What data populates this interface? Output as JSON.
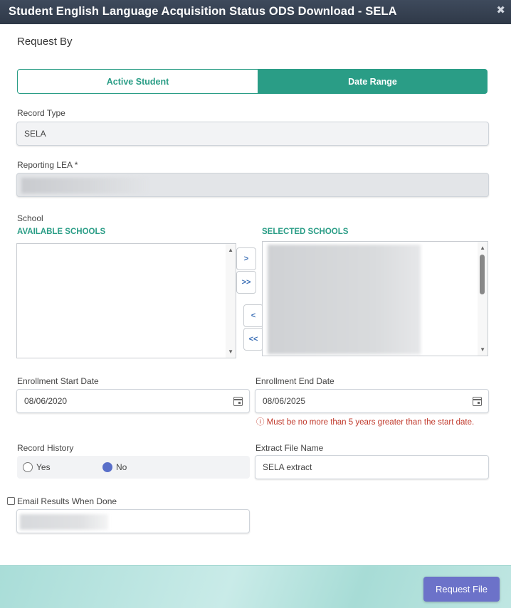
{
  "window": {
    "title": "Student English Language Acquisition Status ODS Download - SELA",
    "close_glyph": "✖"
  },
  "request_by": {
    "heading": "Request By",
    "options": [
      "Active Student",
      "Date Range"
    ],
    "selected": "Date Range"
  },
  "record_type": {
    "label": "Record Type",
    "value": "SELA"
  },
  "reporting_lea": {
    "label": "Reporting LEA *",
    "value": ""
  },
  "school": {
    "label": "School",
    "available_heading": "AVAILABLE SCHOOLS",
    "selected_heading": "SELECTED SCHOOLS",
    "buttons": {
      "add": ">",
      "add_all": ">>",
      "remove": "<",
      "remove_all": "<<"
    }
  },
  "enrollment_start": {
    "label": "Enrollment Start Date",
    "value": "08/06/2020"
  },
  "enrollment_end": {
    "label": "Enrollment End Date",
    "value": "08/06/2025",
    "error_icon": "ⓘ",
    "error": "Must be no more than 5 years greater than the start date."
  },
  "record_history": {
    "label": "Record History",
    "options": [
      "Yes",
      "No"
    ],
    "selected": "No"
  },
  "extract_file": {
    "label": "Extract File Name",
    "value": "SELA extract"
  },
  "email": {
    "label": "Email Results When Done",
    "checked": false
  },
  "footer": {
    "request_button": "Request File"
  },
  "colors": {
    "accent": "#2a9d86",
    "primary_button": "#6c72c9",
    "error": "#c0392b"
  }
}
